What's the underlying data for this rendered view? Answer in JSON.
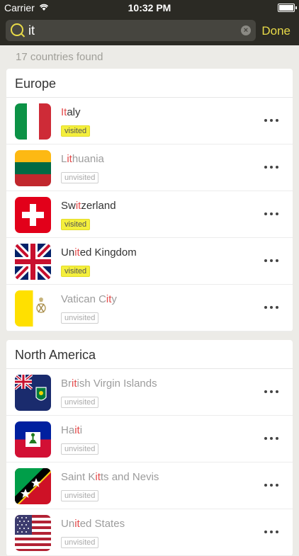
{
  "status_bar": {
    "carrier": "Carrier",
    "time": "10:32 PM"
  },
  "search": {
    "value": "it",
    "done_label": "Done"
  },
  "results_count": "17 countries found",
  "sections": [
    {
      "title": "Europe",
      "rows": [
        {
          "name_parts": [
            "",
            "It",
            "aly"
          ],
          "status": "visited",
          "flag": "italy-flag-icon"
        },
        {
          "name_parts": [
            "L",
            "it",
            "huania"
          ],
          "status": "unvisited",
          "flag": "lithuania-flag-icon"
        },
        {
          "name_parts": [
            "Sw",
            "it",
            "zerland"
          ],
          "status": "visited",
          "flag": "switzerland-flag-icon"
        },
        {
          "name_parts": [
            "Un",
            "it",
            "ed Kingdom"
          ],
          "status": "visited",
          "flag": "uk-flag-icon"
        },
        {
          "name_parts": [
            "Vatican C",
            "it",
            "y"
          ],
          "status": "unvisited",
          "flag": "vatican-flag-icon"
        }
      ]
    },
    {
      "title": "North America",
      "rows": [
        {
          "name_parts": [
            "Br",
            "it",
            "ish Virgin Islands"
          ],
          "status": "unvisited",
          "flag": "bvi-flag-icon"
        },
        {
          "name_parts": [
            "Ha",
            "it",
            "i"
          ],
          "status": "unvisited",
          "flag": "haiti-flag-icon"
        },
        {
          "name_parts": [
            "Saint K",
            "it",
            "ts and Nevis"
          ],
          "status": "unvisited",
          "flag": "saint-kitts-flag-icon"
        },
        {
          "name_parts": [
            "Un",
            "it",
            "ed States"
          ],
          "status": "unvisited",
          "flag": "usa-flag-icon"
        }
      ]
    }
  ],
  "colors": {
    "accent": "#e8da48",
    "highlight": "#e34a4a",
    "visited_badge": "#f4ef3c"
  }
}
